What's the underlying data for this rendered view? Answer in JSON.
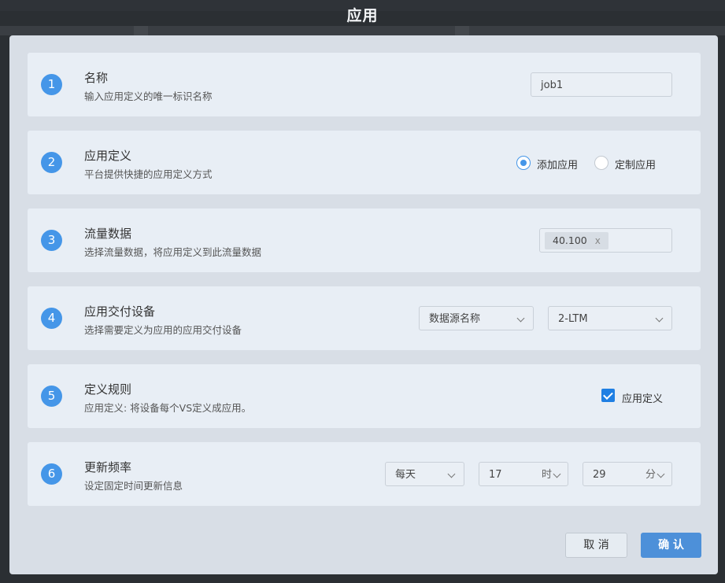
{
  "dialog": {
    "title": "应用"
  },
  "steps": [
    {
      "num": "1",
      "title": "名称",
      "desc": "输入应用定义的唯一标识名称",
      "input_value": "job1"
    },
    {
      "num": "2",
      "title": "应用定义",
      "desc": "平台提供快捷的应用定义方式",
      "options": [
        {
          "label": "添加应用",
          "selected": true
        },
        {
          "label": "定制应用",
          "selected": false
        }
      ]
    },
    {
      "num": "3",
      "title": "流量数据",
      "desc": "选择流量数据，将应用定义到此流量数据",
      "tags": [
        {
          "label": "40.100",
          "remove": "x"
        }
      ]
    },
    {
      "num": "4",
      "title": "应用交付设备",
      "desc": "选择需要定义为应用的应用交付设备",
      "select_source": "数据源名称",
      "select_device": "2-LTM"
    },
    {
      "num": "5",
      "title": "定义规则",
      "desc": "应用定义: 将设备每个VS定义成应用。",
      "checkbox": {
        "label": "应用定义",
        "checked": true
      }
    },
    {
      "num": "6",
      "title": "更新频率",
      "desc": "设定固定时间更新信息",
      "frequency": "每天",
      "hour": "17",
      "hour_unit": "时",
      "minute": "29",
      "minute_unit": "分"
    }
  ],
  "buttons": {
    "cancel": "取 消",
    "confirm": "确 认"
  },
  "colors": {
    "accent": "#4596e8",
    "confirm_button": "#4d90d9",
    "checkbox": "#1f7fe3"
  }
}
